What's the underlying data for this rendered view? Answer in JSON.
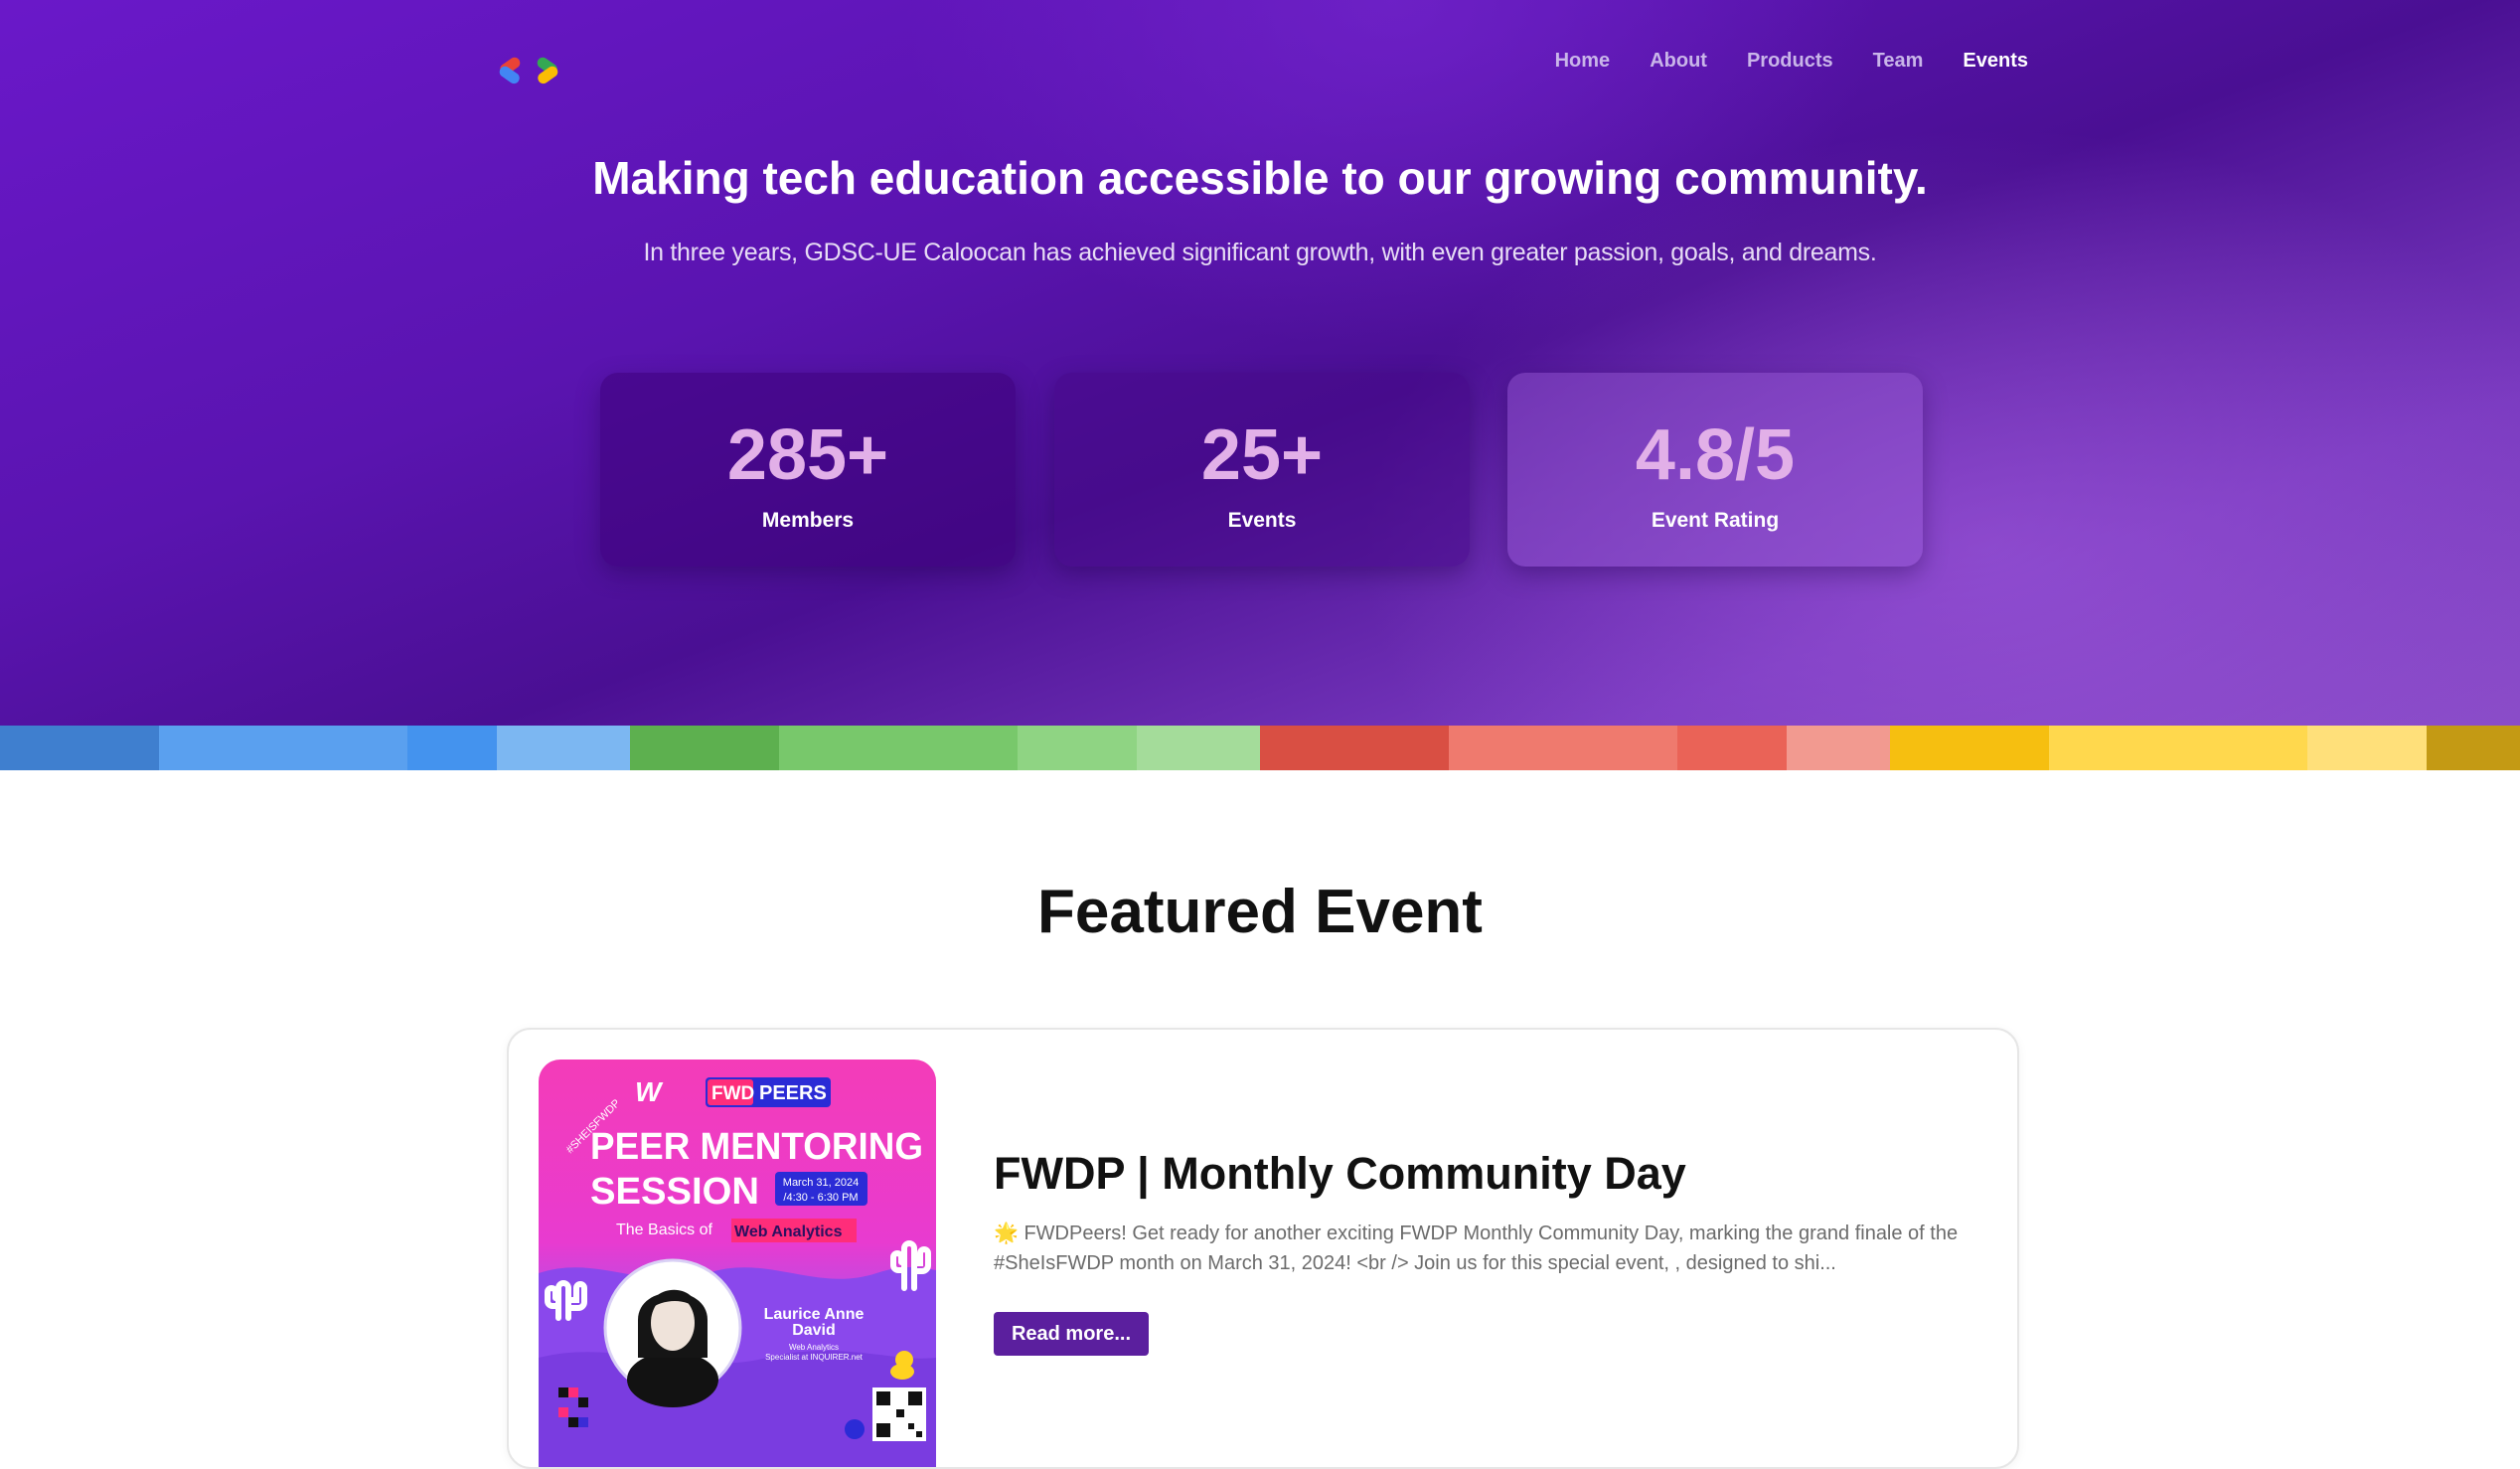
{
  "nav": {
    "logo": "gdsc-brackets-logo",
    "items": [
      {
        "label": "Home",
        "active": false
      },
      {
        "label": "About",
        "active": false
      },
      {
        "label": "Products",
        "active": false
      },
      {
        "label": "Team",
        "active": false
      },
      {
        "label": "Events",
        "active": true
      }
    ]
  },
  "hero": {
    "title": "Making tech education accessible to our growing community.",
    "subtitle": "In three years, GDSC-UE Caloocan has achieved significant growth, with even greater passion, goals, and dreams.",
    "stats": [
      {
        "value": "285+",
        "label": "Members"
      },
      {
        "value": "25+",
        "label": "Events"
      },
      {
        "value": "4.8/5",
        "label": "Event Rating"
      }
    ]
  },
  "featured": {
    "section_title": "Featured Event",
    "event": {
      "title": "FWDP | Monthly Community Day",
      "description": "🌟 FWDPeers! Get ready for another exciting FWDP Monthly Community Day, marking the grand finale of the #SheIsFWDP month on March 31, 2024! <br /> Join us for this special event, , designed to shi...",
      "button": "Read more...",
      "poster": {
        "brand_w": "W",
        "brand_fwd": "FWD",
        "brand_peers": "PEERS",
        "hashtag": "#SHEISFWDP",
        "line1": "PEER MENTORING",
        "line2": "SESSION",
        "date": "March 31, 2024",
        "time": "/4:30 - 6:30 PM",
        "subtitle_prefix": "The Basics of",
        "subtitle_highlight": "Web Analytics",
        "speaker_first": "Laurice Anne",
        "speaker_last": "David",
        "speaker_role_1": "Web Analytics",
        "speaker_role_2": "Specialist at INQUIRER.net"
      }
    }
  },
  "colors": {
    "accent": "#5b1f9e",
    "stat_number": "#e2b0e8",
    "google_blue": "#4a90e2",
    "google_green": "#6abf5c",
    "google_red": "#ec6b5e",
    "google_yellow": "#ffcd2e"
  }
}
